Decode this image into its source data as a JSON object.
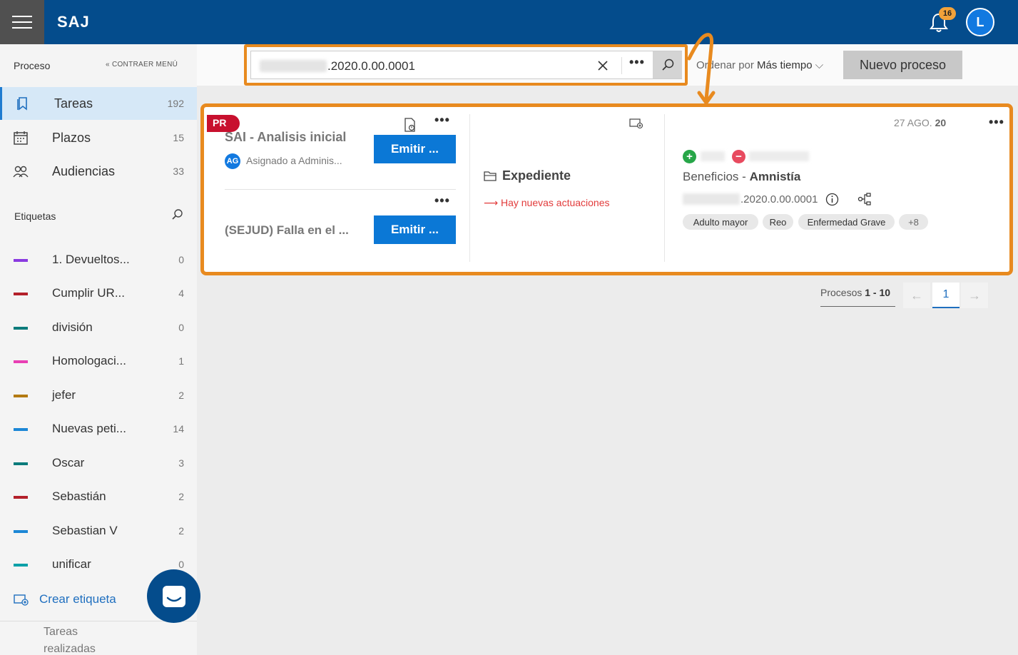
{
  "header": {
    "brand": "SAJ",
    "notifications": "16",
    "user_initial": "L"
  },
  "sidebar": {
    "title": "Proceso",
    "collapse_label": "CONTRAER MENÚ",
    "nav": [
      {
        "label": "Tareas",
        "count": "192"
      },
      {
        "label": "Plazos",
        "count": "15"
      },
      {
        "label": "Audiencias",
        "count": "33"
      }
    ],
    "tags_title": "Etiquetas",
    "tags": [
      {
        "label": "1. Devueltos...",
        "count": "0",
        "color": "#8a3ae0"
      },
      {
        "label": "Cumplir UR...",
        "count": "4",
        "color": "#b3202a"
      },
      {
        "label": "división",
        "count": "0",
        "color": "#0b7b7b"
      },
      {
        "label": "Homologaci...",
        "count": "1",
        "color": "#e83fb4"
      },
      {
        "label": "jefer",
        "count": "2",
        "color": "#b37a12"
      },
      {
        "label": "Nuevas peti...",
        "count": "14",
        "color": "#1c87d6"
      },
      {
        "label": "Oscar",
        "count": "3",
        "color": "#0b7b7b"
      },
      {
        "label": "Sebastián",
        "count": "2",
        "color": "#b3202a"
      },
      {
        "label": "Sebastian V",
        "count": "2",
        "color": "#1c87d6"
      },
      {
        "label": "unificar",
        "count": "0",
        "color": "#0ba0a8"
      }
    ],
    "create_tag": "Crear etiqueta",
    "done_tasks": "Tareas realizadas"
  },
  "search": {
    "value": ".2020.0.00.0001",
    "more": "•••"
  },
  "sort": {
    "prefix": "Ordenar por",
    "value": "Más tiempo"
  },
  "new_process": "Nuevo proceso",
  "card": {
    "badge": "PR",
    "task1": {
      "title": "SAI - Analisis inicial",
      "assignee_initials": "AG",
      "assignee": "Asignado a Adminis...",
      "action": "Emitir ..."
    },
    "task2": {
      "title": "(SEJUD) Falla en el ...",
      "action": "Emitir ..."
    },
    "more": "•••",
    "expediente": {
      "title": "Expediente",
      "alert": "Hay nuevas actuaciones"
    },
    "date_prefix": "27 AGO.",
    "date_year": "20",
    "plus": "+",
    "minus": "−",
    "benefit_prefix": "Beneficios -",
    "benefit_value": "Amnistía",
    "process_number": ".2020.0.00.0001",
    "chips": [
      "Adulto mayor",
      "Reo",
      "Enfermedad Grave",
      "+8"
    ]
  },
  "pagination": {
    "label": "Procesos",
    "range": "1 - 10",
    "current": "1",
    "prev": "←",
    "next": "→"
  }
}
